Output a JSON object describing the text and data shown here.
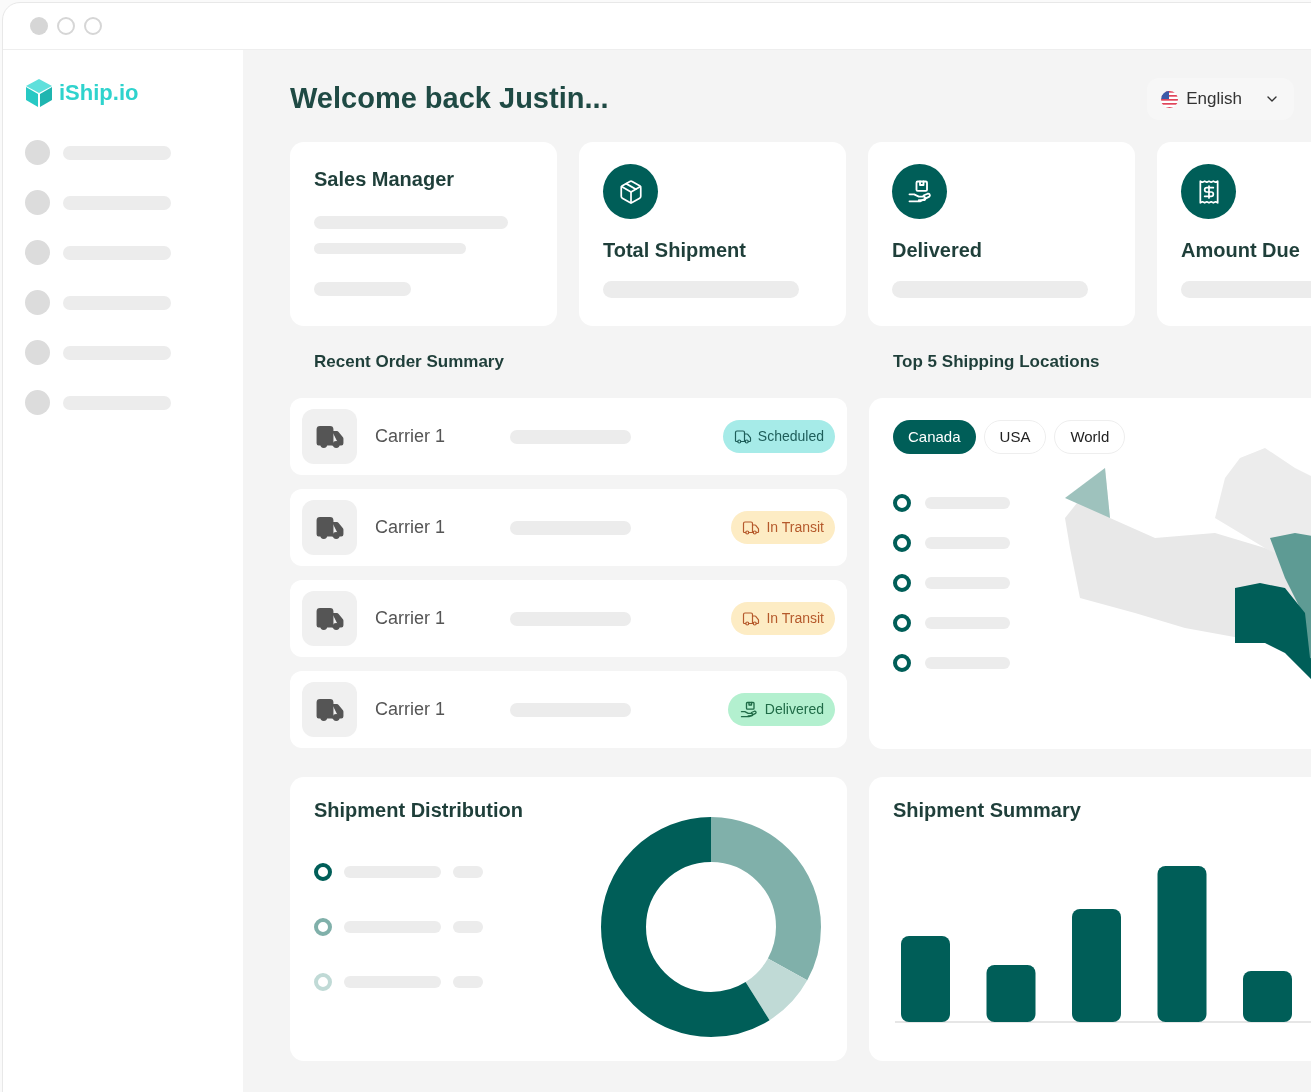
{
  "brand": {
    "name": "iShip.io"
  },
  "header": {
    "title": "Welcome back Justin...",
    "language": "English"
  },
  "stats": [
    {
      "kind": "profile",
      "label": "Sales Manager"
    },
    {
      "kind": "shipment",
      "label": "Total Shipment"
    },
    {
      "kind": "delivered",
      "label": "Delivered"
    },
    {
      "kind": "amount",
      "label": "Amount Due"
    }
  ],
  "orders": {
    "title": "Recent Order Summary",
    "rows": [
      {
        "carrier": "Carrier 1",
        "status": "Scheduled",
        "kind": "scheduled"
      },
      {
        "carrier": "Carrier 1",
        "status": "In Transit",
        "kind": "in_transit"
      },
      {
        "carrier": "Carrier 1",
        "status": "In Transit",
        "kind": "in_transit"
      },
      {
        "carrier": "Carrier 1",
        "status": "Delivered",
        "kind": "delivered"
      }
    ]
  },
  "locations": {
    "title": "Top 5 Shipping Locations",
    "tabs": [
      {
        "label": "Canada",
        "selected": true
      },
      {
        "label": "USA",
        "selected": false
      },
      {
        "label": "World",
        "selected": false
      }
    ]
  },
  "distribution": {
    "title": "Shipment Distribution",
    "legend": [
      {
        "color": "#005e58"
      },
      {
        "color": "#80b0aa"
      },
      {
        "color": "#c0dad6"
      }
    ]
  },
  "summary": {
    "title": "Shipment Summary"
  }
}
